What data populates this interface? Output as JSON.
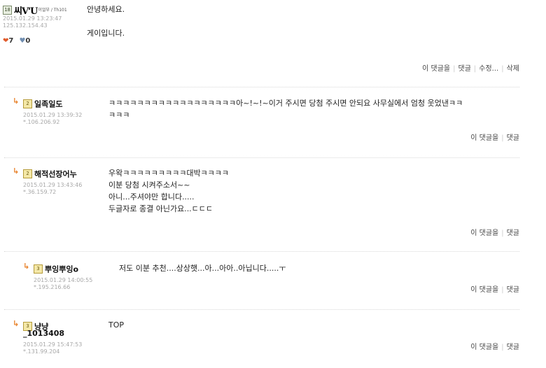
{
  "main_post": {
    "nick_text": "씨V'U",
    "nick_sub": "이얼부 / Th101",
    "date": "2015.01.29 13:23:47",
    "ip": "125.132.154.43",
    "level": "18",
    "likes": "7",
    "dislikes": "0",
    "content_lines": [
      "안녕하세요.",
      "",
      "게이입니다."
    ],
    "actions": [
      "이 댓글을",
      "댓글",
      "수정...",
      "삭제"
    ]
  },
  "comments": [
    {
      "level": "2",
      "nick": "일족일도",
      "date": "2015.01.29 13:39:32",
      "ip": "*.106.206.92",
      "lines": [
        "ㅋㅋㅋㅋㅋㅋㅋㅋㅋㅋㅋㅋㅋㅋㅋㅋㅋㅋ아~!~!~이거 주시면 당첨 주시면 안되요 사무실에서 엄청 웃었낸ㅋㅋ",
        "ㅋㅋㅋ"
      ],
      "actions": [
        "이 댓글을",
        "댓글"
      ]
    },
    {
      "level": "2",
      "nick": "해적선장어누",
      "date": "2015.01.29 13:43:46",
      "ip": "*.36.159.72",
      "lines": [
        "우왁ㅋㅋㅋㅋㅋㅋㅋㅋㅋ대박ㅋㅋㅋㅋ",
        "이분 당첨 시켜주소서~~",
        "아니...주셔야만 합니다.....",
        "두글자로 종결 아닌가요...ㄷㄷㄷ"
      ],
      "actions": [
        "이 댓글을",
        "댓글"
      ]
    },
    {
      "level": "3",
      "nick": "뿌잉뿌잉o",
      "date": "2015.01.29 14:00:55",
      "ip": "*.195.216.66",
      "lines": [
        "저도 이분 추천....상상햇...아...아아..아닙니다.....ㅜ"
      ],
      "actions": [
        "이 댓글을",
        "댓글"
      ]
    },
    {
      "level": "3",
      "nick": "냥냥_1013408",
      "nick_line1": "냥냥",
      "nick_line2": "_1013408",
      "date": "2015.01.29 15:47:53",
      "ip": "*.131.99.204",
      "lines": [
        "TOP"
      ],
      "actions": [
        "이 댓글을",
        "댓글"
      ]
    }
  ],
  "icons": {
    "reply_arrow": "reply-arrow-icon",
    "heart": "heart-icon",
    "dislike": "shield-icon"
  },
  "colors": {
    "reply_arrow": "#e8822a",
    "meta_text": "#a8a8a8",
    "heart": "#e05a2a"
  }
}
